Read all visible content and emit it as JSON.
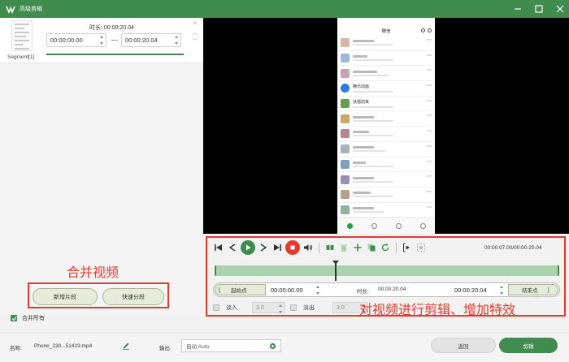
{
  "window": {
    "title": "高级剪辑",
    "accent": "#3f8c4e",
    "controls": [
      "minimize-icon",
      "maximize-icon",
      "close-icon"
    ]
  },
  "segment": {
    "label": "Segment[1]",
    "duration_label": "时长:",
    "duration_value": "00:00:20.04",
    "start_time": "00:00:00.00",
    "end_time": "00:00:20.04",
    "side_icons": [
      "close-icon",
      "chevron-up-icon",
      "chevron-down-icon"
    ]
  },
  "annotations": {
    "merge": "合并视频",
    "edit": "对视频进行剪辑、增加特效",
    "color": "#e23a2e"
  },
  "merge_buttons": {
    "add_segment": "新增片段",
    "quick_split": "快速分段"
  },
  "merge_all": {
    "label": "合并所有",
    "checked": true
  },
  "preview": {
    "app_header": "微信",
    "chat_notes": [
      "腾讯动画",
      "扶摇前来"
    ]
  },
  "player": {
    "time_readout": "00:00:07.00/00:00:20.04",
    "playhead_fraction": 0.35,
    "controls": [
      "jump-start-icon",
      "prev-frame-icon",
      "play-icon",
      "next-frame-icon",
      "jump-end-icon",
      "stop-icon",
      "volume-icon",
      "split-icon",
      "delete-icon",
      "add-icon",
      "copy-icon",
      "reset-icon",
      "mark-in-icon",
      "mark-out-icon"
    ]
  },
  "range": {
    "start_button": "起始点",
    "start_time": "00:00:00.00",
    "duration_label": "时长:",
    "duration_value": "00:00:20.04",
    "end_time": "00:00:20.04",
    "end_button": "结束点"
  },
  "fade": {
    "fade_in_label": "淡入",
    "fade_in_value": "3.0",
    "fade_out_label": "淡出",
    "fade_out_value": "3.0"
  },
  "bottom": {
    "name_label": "名称:",
    "file_name": "Phone_230...51419.mp4",
    "output_label": "输出:",
    "output_value": "自动;Auto",
    "back_button": "返回",
    "cut_button": "剪辑"
  }
}
